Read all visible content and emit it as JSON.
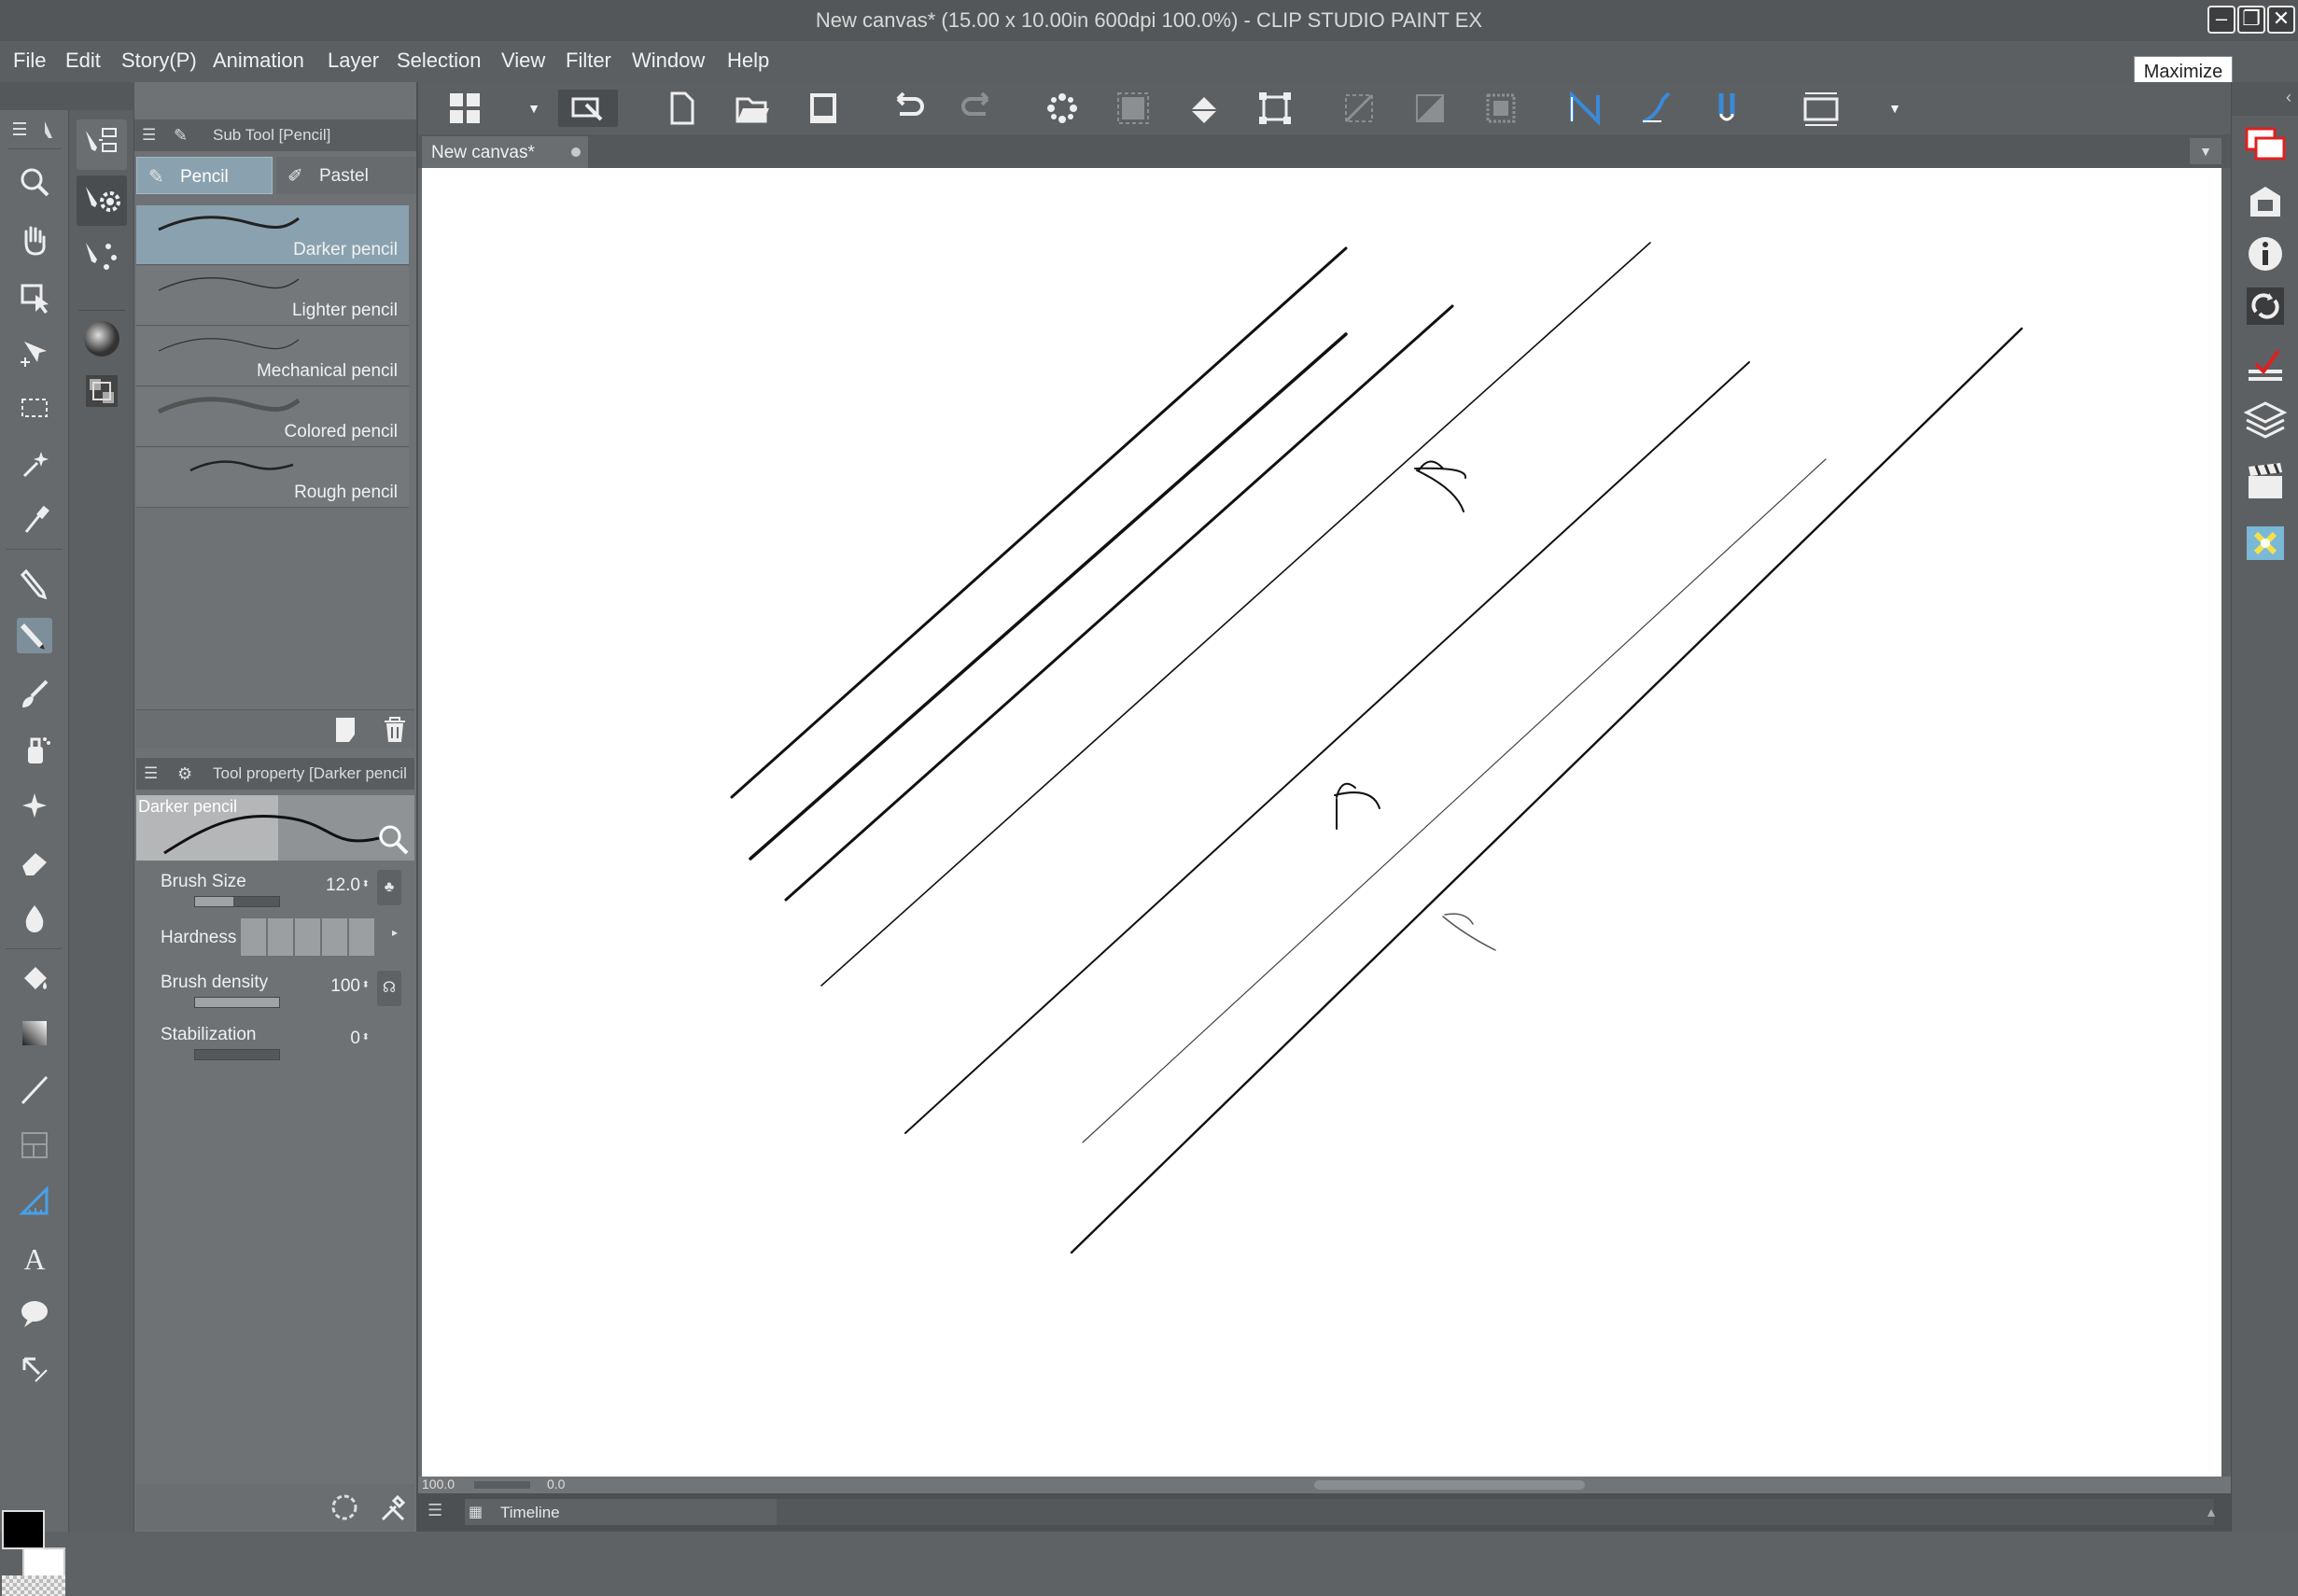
{
  "window": {
    "title": "New canvas* (15.00 x 10.00in 600dpi 100.0%)  - CLIP STUDIO PAINT EX",
    "tooltip": "Maximize",
    "min_glyph": "–",
    "max_glyph": "❐",
    "close_glyph": "✕"
  },
  "menu": [
    "File",
    "Edit",
    "Story(P)",
    "Animation",
    "Layer",
    "Selection",
    "View",
    "Filter",
    "Window",
    "Help"
  ],
  "sub_tool_panel": {
    "header": "Sub Tool [Pencil]",
    "tabs": [
      "Pencil",
      "Pastel"
    ],
    "brushes": [
      {
        "label": "Darker pencil",
        "selected": true
      },
      {
        "label": "Lighter pencil",
        "selected": false
      },
      {
        "label": "Mechanical pencil",
        "selected": false
      },
      {
        "label": "Colored pencil",
        "selected": false
      },
      {
        "label": "Rough pencil",
        "selected": false
      }
    ]
  },
  "tool_property": {
    "header": "Tool property [Darker pencil",
    "preview_label": "Darker pencil",
    "brush_size_label": "Brush Size",
    "brush_size_value": "12.0",
    "brush_size_level": 0.45,
    "hardness_label": "Hardness",
    "hardness_level": 5,
    "brush_density_label": "Brush density",
    "brush_density_value": "100",
    "brush_density_level": 1.0,
    "stabilization_label": "Stabilization",
    "stabilization_value": "0",
    "stabilization_level": 0.0
  },
  "document_tab": {
    "label": "New canvas*"
  },
  "status": {
    "zoom": "100.0",
    "angle": "0.0"
  },
  "timeline": {
    "label": "Timeline"
  },
  "colors": {
    "main_color": "#000000",
    "sub_color": "#ffffff",
    "accent": "#3a8ad8",
    "selected_row": "#8aa2b0"
  },
  "icons": {
    "tools": [
      "zoom-icon",
      "hand-icon",
      "operation-icon",
      "move-layer-icon",
      "selection-icon",
      "auto-select-icon",
      "eyedropper-icon",
      "pen-icon",
      "pencil-icon",
      "brush-icon",
      "airbrush-icon",
      "decoration-icon",
      "eraser-icon",
      "blend-icon",
      "fill-icon",
      "gradient-icon",
      "figure-icon",
      "frame-icon",
      "ruler-icon",
      "text-icon",
      "balloon-icon",
      "correct-line-icon"
    ],
    "commands": [
      "app-launcher-icon",
      "dropdown-icon",
      "clip-studio-icon",
      "new-icon",
      "open-icon",
      "save-icon",
      "undo-icon",
      "redo-icon",
      "clear-icon",
      "transform-frame-icon",
      "fill-selection-icon",
      "scale-icon",
      "deselect-icon",
      "invert-selection-icon",
      "show-selection-icon",
      "snap-ruler-icon",
      "snap-special-ruler-icon",
      "snap-grid-icon",
      "fit-icon",
      "more-icon"
    ],
    "right_panels": [
      "navigator-icon",
      "sub-view-icon",
      "item-info-icon",
      "layer-property-icon",
      "layer-search-icon",
      "layers-icon",
      "animation-cels-icon",
      "material-icon"
    ]
  }
}
